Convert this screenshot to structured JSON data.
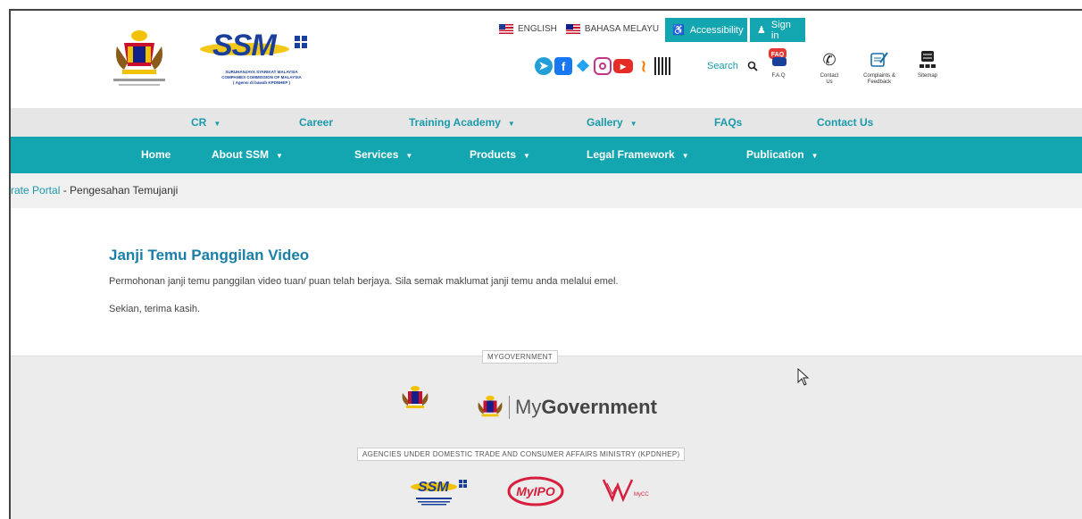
{
  "colors": {
    "teal": "#13a5b0",
    "link": "#1a9aaa",
    "title": "#1a7fa8",
    "subnav_bg": "#e6e6e6",
    "footer_bg": "#ececec"
  },
  "header": {
    "ssm_logo_word": "SSM",
    "ssm_logo_caption": "SURUHANJAYA SYARIKAT MALAYSIA\nCOMPANIES COMMISSION OF MALAYSIA\n( Agensi di bawah KPDNHEP )",
    "lang_english": "ENGLISH",
    "lang_malay": "BAHASA MELAYU",
    "accessibility": "Accessibility",
    "signin": "Sign in",
    "search_label": "Search",
    "faq_label": "F.A.Q",
    "contact_label": "Contact Us",
    "complaints_label": "Complaints & Feedback",
    "sitemap_label": "Sitemap",
    "social_icons": [
      "telegram-icon",
      "facebook-icon",
      "twitter-icon",
      "instagram-icon",
      "youtube-icon",
      "rss-icon",
      "qr-code-icon"
    ]
  },
  "subnav": {
    "items": [
      {
        "label": "CR",
        "dropdown": true
      },
      {
        "label": "Career",
        "dropdown": false
      },
      {
        "label": "Training Academy",
        "dropdown": true
      },
      {
        "label": "Gallery",
        "dropdown": true
      },
      {
        "label": "FAQs",
        "dropdown": false
      },
      {
        "label": "Contact Us",
        "dropdown": false
      }
    ]
  },
  "mainnav": {
    "items": [
      {
        "label": "Home",
        "dropdown": false
      },
      {
        "label": "About SSM",
        "dropdown": true
      },
      {
        "label": "Services",
        "dropdown": true
      },
      {
        "label": "Products",
        "dropdown": true
      },
      {
        "label": "Legal Framework",
        "dropdown": true
      },
      {
        "label": "Publication",
        "dropdown": true
      }
    ]
  },
  "breadcrumb": {
    "link": "rate Portal",
    "separator": " - ",
    "current": "Pengesahan Temujanji"
  },
  "content": {
    "title": "Janji Temu Panggilan Video",
    "paragraph1": "Permohonan janji temu panggilan video tuan/ puan telah berjaya. Sila semak maklumat janji temu anda melalui emel.",
    "paragraph2": "Sekian, terima kasih."
  },
  "footer": {
    "mygov_label": "MYGOVERNMENT",
    "mygov_logo_text_1": "My",
    "mygov_logo_text_2": "Government",
    "agencies_label": "AGENCIES UNDER DOMESTIC TRADE AND CONSUMER AFFAIRS MINISTRY (KPDNHEP)",
    "agency_logos": [
      "SSM",
      "MyIPO",
      "MyCC"
    ]
  }
}
